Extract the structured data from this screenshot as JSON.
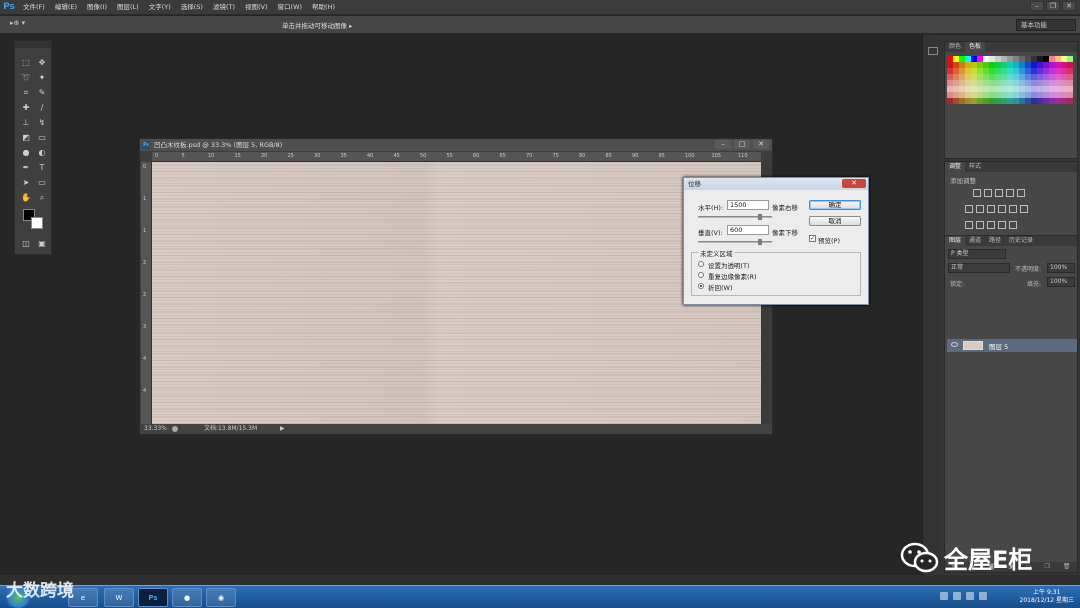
{
  "app": {
    "logo": "Ps"
  },
  "menu": [
    "文件(F)",
    "编辑(E)",
    "图像(I)",
    "图层(L)",
    "文字(Y)",
    "选择(S)",
    "滤镜(T)",
    "视图(V)",
    "窗口(W)",
    "帮助(H)"
  ],
  "options_bar": {
    "tool_glyph": "▸⊕ ▾",
    "hint": "单击并拖动可移动图像 ▸",
    "workspace": "基本功能"
  },
  "document": {
    "title": "凹凸木纹板.psd @ 33.3% (图层 5, RGB/8)",
    "icon": "Ps",
    "ruler_top": [
      "0",
      "5",
      "10",
      "15",
      "20",
      "25",
      "30",
      "35",
      "40",
      "45",
      "50",
      "55",
      "60",
      "65",
      "70",
      "75",
      "80",
      "85",
      "90",
      "95",
      "100",
      "105",
      "110"
    ],
    "ruler_left": [
      "0",
      "1",
      "1",
      "2",
      "2",
      "3",
      "4",
      "4"
    ],
    "zoom": "33.33%",
    "doc_info": "文档:13.8M/15.3M"
  },
  "dialog": {
    "title": "位移",
    "horizontal_label": "水平(H):",
    "horizontal_value": "1500",
    "horizontal_unit": "像素右移",
    "vertical_label": "垂直(V):",
    "vertical_value": "600",
    "vertical_unit": "像素下移",
    "ok_label": "确定",
    "cancel_label": "取消",
    "preview_label": "预览(P)",
    "preview_checked": true,
    "group_title": "未定义区域",
    "options": [
      "设置为透明(T)",
      "重复边缘像素(R)",
      "折回(W)"
    ],
    "selected_option": 2
  },
  "swatches_panel": {
    "tabs": [
      "颜色",
      "色板"
    ],
    "active_tab": 1
  },
  "adjustments_panel": {
    "tabs": [
      "调整",
      "样式"
    ],
    "active_tab": 0,
    "heading": "添加调整"
  },
  "layers_panel": {
    "tabs": [
      "图层",
      "通道",
      "路径",
      "历史记录"
    ],
    "active_tab": 0,
    "filter_label": "P 类型",
    "blend_mode": "正常",
    "opacity_label": "不透明度:",
    "opacity_value": "100%",
    "lock_label": "锁定:",
    "fill_label": "填充:",
    "fill_value": "100%",
    "layer_name": "图层 5"
  },
  "taskbar": {
    "time": "上午 9:31",
    "date": "2018/12/12 星期三"
  },
  "watermarks": {
    "left": "大数跨境",
    "right": "全屋E柜"
  },
  "colors": {
    "accent": "#3aa0e8",
    "layer_selected": "#5b6a7c",
    "taskbar": "#2d6fb6"
  }
}
